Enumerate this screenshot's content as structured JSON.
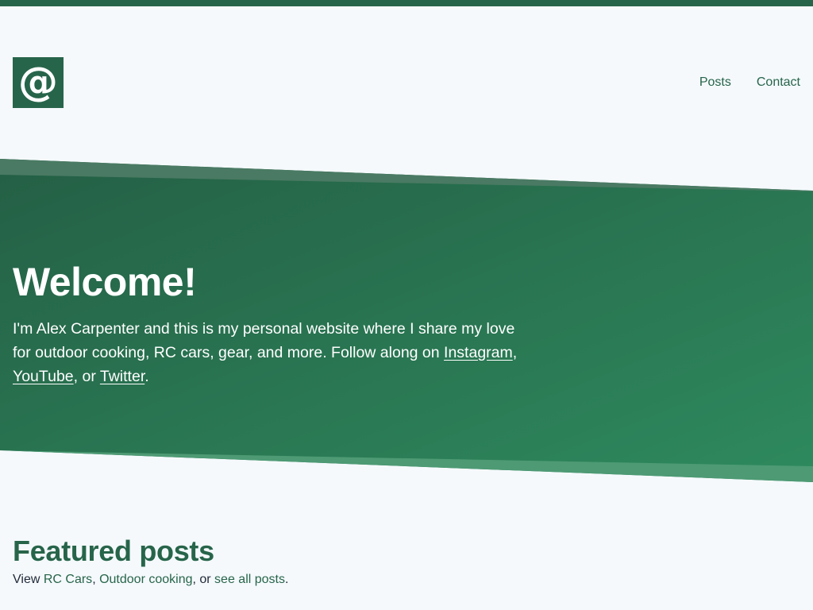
{
  "header": {
    "logo_glyph": "@",
    "nav": [
      {
        "label": "Posts"
      },
      {
        "label": "Contact"
      }
    ]
  },
  "hero": {
    "title": "Welcome!",
    "intro": "I'm Alex Carpenter and this is my personal website where I share my love for outdoor cooking, RC cars, gear, and more. Follow along on ",
    "links": [
      {
        "label": "Instagram"
      },
      {
        "label": "YouTube"
      },
      {
        "label": "Twitter"
      }
    ],
    "sep_1": ", ",
    "sep_2": ", or ",
    "end": "."
  },
  "featured": {
    "title": "Featured posts",
    "prefix": "View ",
    "links": [
      {
        "label": "RC Cars"
      },
      {
        "label": "Outdoor cooking"
      },
      {
        "label": "see all posts"
      }
    ],
    "sep_1": ", ",
    "sep_2": ", or ",
    "end": "."
  },
  "colors": {
    "brand_green": "#27654a",
    "hero_green_light": "#2e8a5e",
    "background": "#f5f9fc",
    "text_dark": "#1f2937"
  },
  "icons": {
    "logo": "at-sign-icon"
  }
}
